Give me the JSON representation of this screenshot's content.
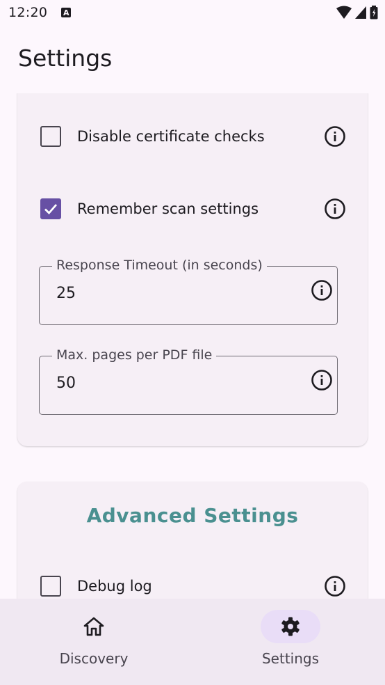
{
  "status_bar": {
    "time": "12:20",
    "notification_icon_letter": "A"
  },
  "app_bar": {
    "title": "Settings"
  },
  "general_settings": {
    "disable_cert_checks": {
      "label": "Disable certificate checks",
      "checked": false
    },
    "remember_scan_settings": {
      "label": "Remember scan settings",
      "checked": true
    },
    "response_timeout": {
      "label": "Response Timeout (in seconds)",
      "value": "25"
    },
    "max_pages": {
      "label": "Max. pages per PDF file",
      "value": "50"
    }
  },
  "advanced_settings": {
    "title": "Advanced Settings",
    "debug_log": {
      "label": "Debug log",
      "checked": false
    }
  },
  "bottom_nav": {
    "items": [
      {
        "label": "Discovery",
        "icon": "home-icon",
        "selected": false
      },
      {
        "label": "Settings",
        "icon": "gear-icon",
        "selected": true
      }
    ]
  },
  "colors": {
    "accent": "#6750a4",
    "section_title": "#4a9090",
    "background": "#fdf7fd",
    "card": "#f6eff6",
    "nav_pill": "#e9ddf7"
  }
}
